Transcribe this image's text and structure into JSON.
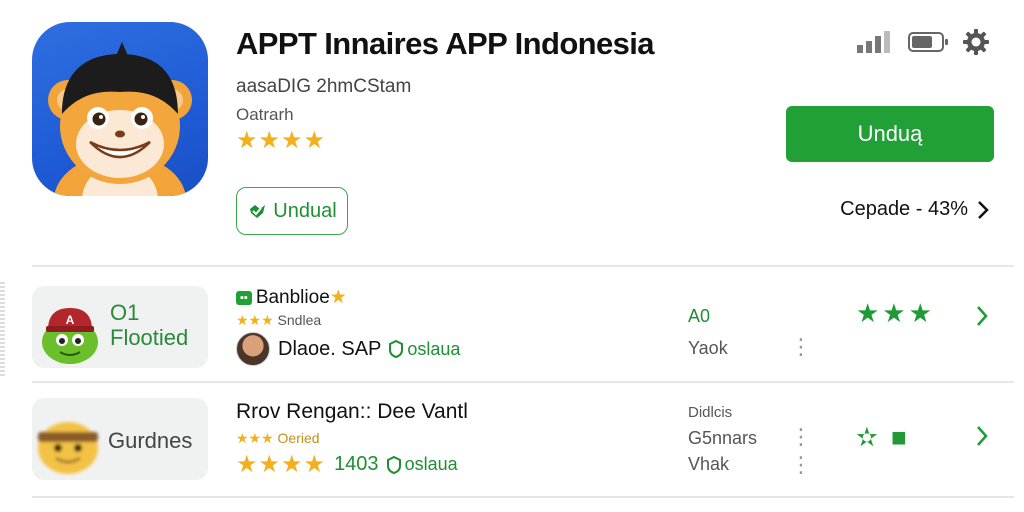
{
  "app": {
    "title": "APPT Innaires APP Indonesia",
    "subtitle": "aasaDIG 2hmCStam",
    "category": "Oatrarh",
    "stars": "★★★★",
    "install_label": "Undual",
    "primary_button": "Unduą",
    "progress_text": "Cepade - 43%",
    "progress_value": 43
  },
  "status": {
    "battery_level": 0.7,
    "icons": [
      "signal-icon",
      "battery-icon",
      "gear-icon"
    ]
  },
  "list": [
    {
      "thumb_label": "O1\nFlootied",
      "title": "Banblioe",
      "title_star": "★",
      "small": "Sndlea",
      "small_stars": "★★★",
      "meta_name": "Dlaoe. SAP",
      "tag": "oslaua",
      "col_top": "A0",
      "col_bottom": "Yaok",
      "rank_stars": "★★★"
    },
    {
      "thumb_label": "Gurdnes",
      "title": "Rrov Rengan:: Dee Vantl",
      "small": "Oeried",
      "small_stars": "★★★",
      "meta_stars": "★★★★",
      "meta_count": "1403",
      "tag": "oslaua",
      "col_top": "Didlcis",
      "col_mid": "G5nnars",
      "col_bottom": "Vhak",
      "rank_stars": "✫ ■"
    }
  ],
  "colors": {
    "accent_green": "#21a038",
    "star_gold": "#f2b01e",
    "icon_blue": "#1f5bd6"
  }
}
